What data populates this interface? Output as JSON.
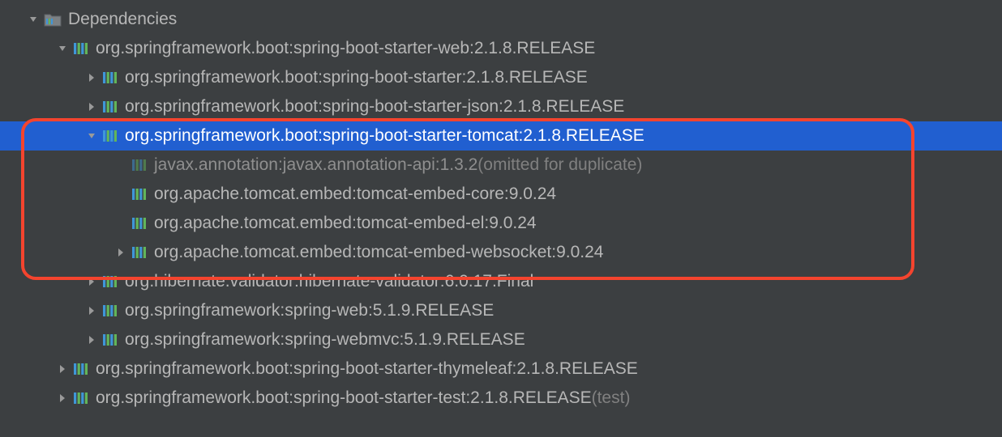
{
  "root": {
    "label": "Dependencies"
  },
  "items": [
    {
      "indent": 1,
      "arrow": "down",
      "icon": "mod",
      "key": "l0"
    },
    {
      "indent": 2,
      "arrow": "right",
      "icon": "mod",
      "key": "l1"
    },
    {
      "indent": 2,
      "arrow": "right",
      "icon": "mod",
      "key": "l2"
    },
    {
      "indent": 2,
      "arrow": "down",
      "icon": "mod",
      "key": "l3",
      "selected": true
    },
    {
      "indent": 3,
      "arrow": "",
      "icon": "mod",
      "key": "l4",
      "dim": true,
      "suffixKey": "s4"
    },
    {
      "indent": 3,
      "arrow": "",
      "icon": "mod",
      "key": "l5"
    },
    {
      "indent": 3,
      "arrow": "",
      "icon": "mod",
      "key": "l6"
    },
    {
      "indent": 3,
      "arrow": "right",
      "icon": "mod",
      "key": "l7"
    },
    {
      "indent": 2,
      "arrow": "right",
      "icon": "mod",
      "key": "l8"
    },
    {
      "indent": 2,
      "arrow": "right",
      "icon": "mod",
      "key": "l9"
    },
    {
      "indent": 2,
      "arrow": "right",
      "icon": "mod",
      "key": "l10"
    },
    {
      "indent": 1,
      "arrow": "right",
      "icon": "mod",
      "key": "l11"
    },
    {
      "indent": 1,
      "arrow": "right",
      "icon": "mod",
      "key": "l12",
      "suffixKey": "s12"
    }
  ],
  "labels": {
    "l0": "org.springframework.boot:spring-boot-starter-web:2.1.8.RELEASE",
    "l1": "org.springframework.boot:spring-boot-starter:2.1.8.RELEASE",
    "l2": "org.springframework.boot:spring-boot-starter-json:2.1.8.RELEASE",
    "l3": "org.springframework.boot:spring-boot-starter-tomcat:2.1.8.RELEASE",
    "l4": "javax.annotation:javax.annotation-api:1.3.2",
    "l5": "org.apache.tomcat.embed:tomcat-embed-core:9.0.24",
    "l6": "org.apache.tomcat.embed:tomcat-embed-el:9.0.24",
    "l7": "org.apache.tomcat.embed:tomcat-embed-websocket:9.0.24",
    "l8": "org.hibernate.validator:hibernate-validator:6.0.17.Final",
    "l9": "org.springframework:spring-web:5.1.9.RELEASE",
    "l10": "org.springframework:spring-webmvc:5.1.9.RELEASE",
    "l11": "org.springframework.boot:spring-boot-starter-thymeleaf:2.1.8.RELEASE",
    "l12": "org.springframework.boot:spring-boot-starter-test:2.1.8.RELEASE",
    "s4": " (omitted for duplicate)",
    "s12": " (test)"
  },
  "colors": {
    "selected_bg": "#215fd0",
    "highlight_border": "#f4442e"
  }
}
